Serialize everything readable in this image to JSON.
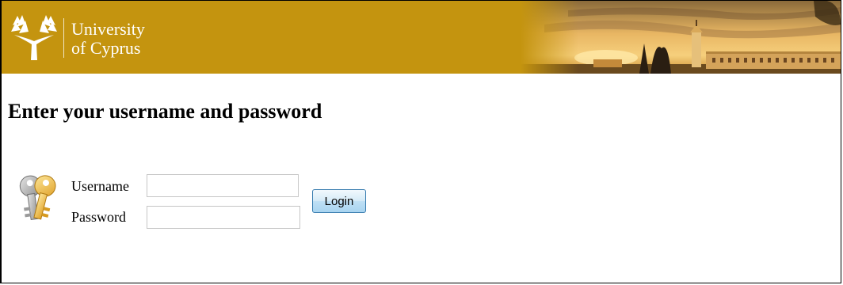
{
  "header": {
    "logo_line1": "University",
    "logo_line2": "of Cyprus",
    "brand_color": "#c4940f",
    "logo_icon": "olive-tree-icon",
    "banner_image": "sunset-campus-banner"
  },
  "main": {
    "title": "Enter your username and password",
    "key_icon": "keys-icon"
  },
  "form": {
    "username_label": "Username",
    "username_value": "",
    "password_label": "Password",
    "password_value": "",
    "login_label": "Login",
    "login_button_color": "#bfe0f5"
  }
}
